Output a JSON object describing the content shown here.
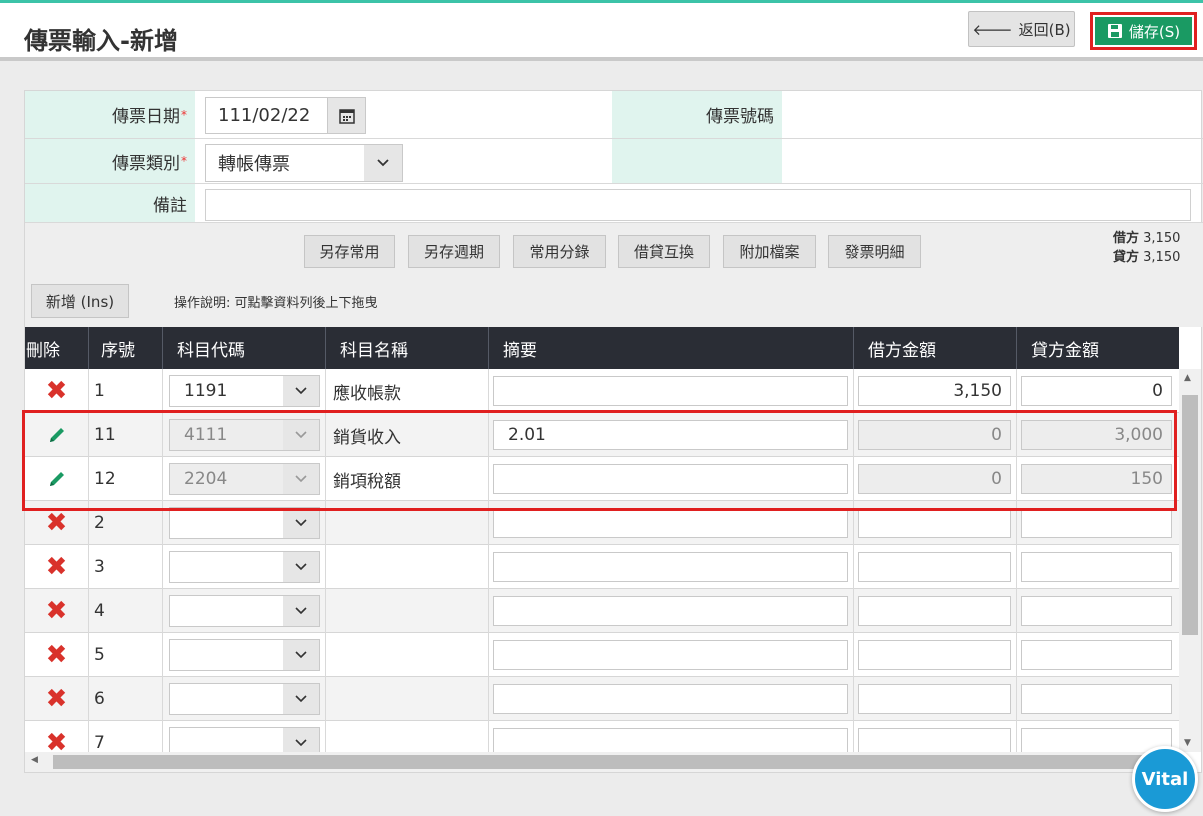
{
  "header": {
    "title": "傳票輸入-新增",
    "back_label": "返回(B)",
    "save_label": "儲存(S)"
  },
  "form": {
    "date_label": "傳票日期",
    "date_value": "111/02/22",
    "voucher_no_label": "傳票號碼",
    "voucher_no_value": "",
    "type_label": "傳票類別",
    "type_value": "轉帳傳票",
    "note_label": "備註",
    "note_value": "",
    "required_mark": "*"
  },
  "toolbar": {
    "buttons": [
      "另存常用",
      "另存週期",
      "常用分錄",
      "借貸互換",
      "附加檔案",
      "發票明細"
    ],
    "debit_label": "借方",
    "debit_total": "3,150",
    "credit_label": "貸方",
    "credit_total": "3,150",
    "add_label": "新增 (Ins)",
    "hint": "操作說明: 可點擊資料列後上下拖曳"
  },
  "table": {
    "headers": [
      "刪除",
      "序號",
      "科目代碼",
      "科目名稱",
      "摘要",
      "借方金額",
      "貸方金額"
    ],
    "rows": [
      {
        "action": "delete",
        "seq": "1",
        "code": "1191",
        "name": "應收帳款",
        "memo": "",
        "debit": "3,150",
        "credit": "0",
        "locked": false
      },
      {
        "action": "edit",
        "seq": "11",
        "code": "4111",
        "name": "銷貨收入",
        "memo": "2.01",
        "debit": "0",
        "credit": "3,000",
        "locked": true
      },
      {
        "action": "edit",
        "seq": "12",
        "code": "2204",
        "name": "銷項稅額",
        "memo": "",
        "debit": "0",
        "credit": "150",
        "locked": true
      },
      {
        "action": "delete",
        "seq": "2",
        "code": "",
        "name": "",
        "memo": "",
        "debit": "",
        "credit": "",
        "locked": false
      },
      {
        "action": "delete",
        "seq": "3",
        "code": "",
        "name": "",
        "memo": "",
        "debit": "",
        "credit": "",
        "locked": false
      },
      {
        "action": "delete",
        "seq": "4",
        "code": "",
        "name": "",
        "memo": "",
        "debit": "",
        "credit": "",
        "locked": false
      },
      {
        "action": "delete",
        "seq": "5",
        "code": "",
        "name": "",
        "memo": "",
        "debit": "",
        "credit": "",
        "locked": false
      },
      {
        "action": "delete",
        "seq": "6",
        "code": "",
        "name": "",
        "memo": "",
        "debit": "",
        "credit": "",
        "locked": false
      },
      {
        "action": "delete",
        "seq": "7",
        "code": "",
        "name": "",
        "memo": "",
        "debit": "",
        "credit": "",
        "locked": false
      }
    ]
  },
  "badge": "Vital",
  "colors": {
    "accent": "#1a9a63",
    "highlight": "#e02020",
    "header_bg": "#2a2d35",
    "label_bg": "#e0f4ee"
  }
}
